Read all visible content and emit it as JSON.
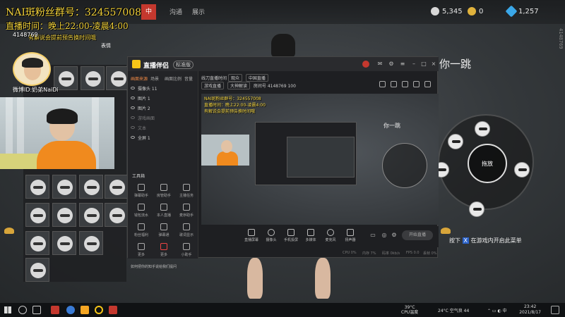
{
  "game": {
    "tabs": [
      "中",
      "沟通",
      "展示"
    ],
    "currencies": [
      {
        "value": "5,345",
        "icon": "coin-icon",
        "color": "#d8d8d8"
      },
      {
        "value": "0",
        "icon": "gold-coin-icon",
        "color": "#e0b23c"
      },
      {
        "value": "1,257",
        "icon": "diamond-icon",
        "color": "#3aa7e8"
      }
    ],
    "caption": "你一跳",
    "wheel_center_label": "拖放",
    "hint_prefix": "按下",
    "hint_key": "X",
    "hint_suffix": "在游戏内开启此菜单",
    "side_vertical_text": "4148769"
  },
  "overlay": {
    "line1": "NAI斑粉丝群号：324557008",
    "line2": "直播时间：晚上22:00-凌晨4:00",
    "line3": "有解说会提前预告换时间哦",
    "streamer_id": "4148769",
    "emote_label": "表情",
    "weibo": "微博ID:奶弟NaiDi"
  },
  "app": {
    "name": "直播伴侣",
    "version": "标准版",
    "source_tabs": [
      "画面来源",
      "场景",
      "画面比例",
      "音量"
    ],
    "sources": [
      "摄像头 11",
      "图片 1",
      "图片 2",
      "游戏画面",
      "文本",
      "全屏 1"
    ],
    "tools_title": "工具箱",
    "tools": [
      "弹幕助手",
      "房管助手",
      "主播任务",
      "钱包流水",
      "本人直播",
      "麦序助手",
      "粉丝福利",
      "弹幕通",
      "歌词显示",
      "更多",
      "更多",
      "小助手"
    ],
    "notice": "如何把你的知乎说给我们提问",
    "info_title": "线刀直播时间",
    "info_chip1": "观众",
    "info_chip2": "中国直播",
    "info_category": "游戏直播",
    "info_area": "大神解读",
    "info_room_label": "房间号",
    "info_room": "4148769",
    "info_count": "100",
    "stats": [
      "5.345",
      "0",
      "1,257"
    ],
    "toolbar": [
      "直播屏幕",
      "摄像头",
      "手机投屏",
      "多媒体",
      "麦克风",
      "扬声器"
    ],
    "start_button": "开始直播",
    "status": [
      "CPU 0%",
      "内存 7%",
      "码率 0kb/s",
      "FPS 0.0",
      "丢帧 0%"
    ]
  },
  "taskbar": {
    "temp": "39°C",
    "temp_label": "CPU温度",
    "weather": "24°C 空气良 44",
    "time": "23:42",
    "date": "2021/8/17"
  }
}
